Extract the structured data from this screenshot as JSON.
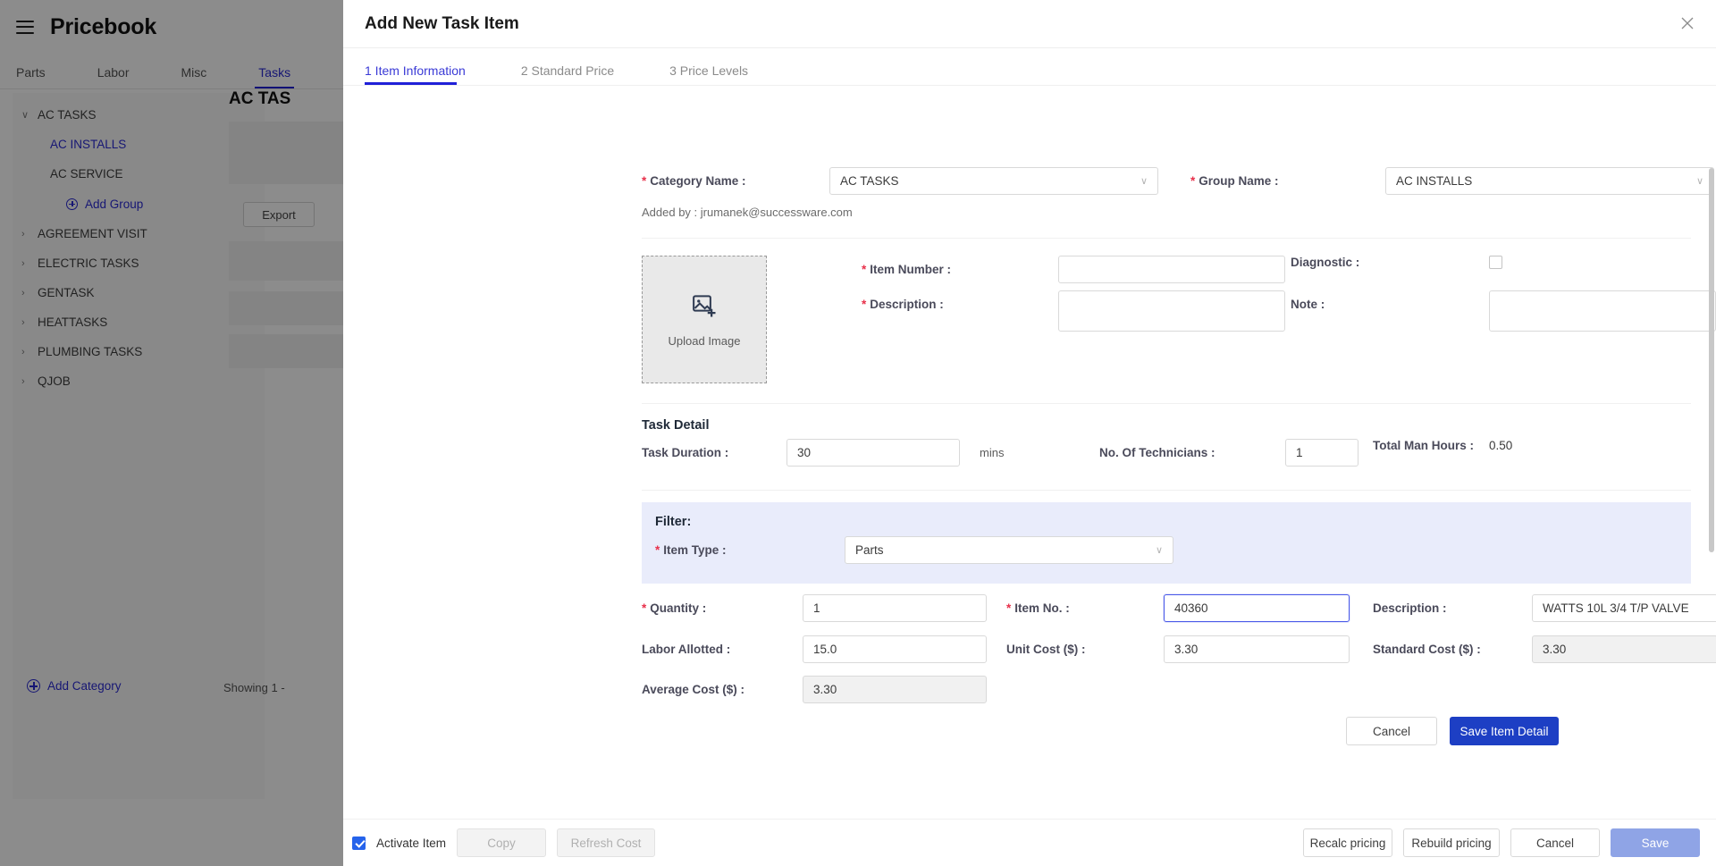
{
  "background": {
    "app_title": "Pricebook",
    "menu_icon": "hamburger-icon",
    "tabs": [
      {
        "label": "Parts",
        "active": false
      },
      {
        "label": "Labor",
        "active": false
      },
      {
        "label": "Misc",
        "active": false
      },
      {
        "label": "Tasks",
        "active": true
      }
    ],
    "tree": [
      {
        "label": "AC TASKS",
        "caret": "∨",
        "level": 0,
        "expanded": true
      },
      {
        "label": "AC INSTALLS",
        "level": 1,
        "selected": true
      },
      {
        "label": "AC SERVICE",
        "level": 1,
        "selected": false
      },
      {
        "label": "AGREEMENT VISIT",
        "caret": "›",
        "level": 0,
        "expanded": false
      },
      {
        "label": "ELECTRIC TASKS",
        "caret": "›",
        "level": 0,
        "expanded": false
      },
      {
        "label": "GENTASK",
        "caret": "›",
        "level": 0,
        "expanded": false
      },
      {
        "label": "HEATTASKS",
        "caret": "›",
        "level": 0,
        "expanded": false
      },
      {
        "label": "PLUMBING TASKS",
        "caret": "›",
        "level": 0,
        "expanded": false
      },
      {
        "label": "QJOB",
        "caret": "›",
        "level": 0,
        "expanded": false
      }
    ],
    "add_group_label": "Add Group",
    "add_category_label": "Add Category",
    "content_title": "AC TAS",
    "export_label": "Export",
    "showing_text": "Showing 1 -"
  },
  "modal": {
    "title": "Add New Task Item",
    "close_icon": "close-icon",
    "steps": [
      {
        "label": "1 Item Information",
        "active": true
      },
      {
        "label": "2 Standard Price",
        "active": false
      },
      {
        "label": "3 Price Levels",
        "active": false
      }
    ],
    "category": {
      "label": "Category Name :",
      "value": "AC TASKS",
      "required": true
    },
    "group": {
      "label": "Group Name :",
      "value": "AC INSTALLS",
      "required": true
    },
    "added_by": "Added by : jrumanek@successware.com",
    "upload": {
      "label": "Upload Image",
      "icon": "image-upload-icon"
    },
    "item_number": {
      "label": "Item Number :",
      "value": "",
      "placeholder": "",
      "required": true
    },
    "description": {
      "label": "Description :",
      "value": "",
      "placeholder": "",
      "required": true
    },
    "diagnostic": {
      "label": "Diagnostic :",
      "checked": false
    },
    "note": {
      "label": "Note :",
      "value": "",
      "placeholder": ""
    },
    "task_detail": {
      "title": "Task Detail",
      "duration_label": "Task Duration :",
      "duration_value": "30",
      "duration_unit": "mins",
      "technicians_label": "No. Of Technicians :",
      "technicians_value": "1",
      "man_hours_label": "Total Man Hours :",
      "man_hours_value": "0.50"
    },
    "filter": {
      "title": "Filter:",
      "item_type_label": "Item Type :",
      "item_type_value": "Parts",
      "required": true
    },
    "line_item": {
      "quantity_label": "Quantity :",
      "quantity_value": "1",
      "item_no_label": "Item No. :",
      "item_no_value": "40360",
      "description_label": "Description :",
      "description_value": "WATTS 10L 3/4 T/P VALVE",
      "labor_allotted_label": "Labor Allotted :",
      "labor_allotted_value": "15.0",
      "unit_cost_label": "Unit Cost ($) :",
      "unit_cost_value": "3.30",
      "standard_cost_label": "Standard Cost ($) :",
      "standard_cost_value": "3.30",
      "average_cost_label": "Average Cost ($) :",
      "average_cost_value": "3.30"
    },
    "item_actions": {
      "cancel_label": "Cancel",
      "save_item_label": "Save Item Detail"
    },
    "footer": {
      "activate_label": "Activate Item",
      "activate_checked": true,
      "copy_label": "Copy",
      "copy_disabled": true,
      "refresh_cost_label": "Refresh Cost",
      "refresh_cost_disabled": true,
      "recalc_label": "Recalc pricing",
      "rebuild_label": "Rebuild pricing",
      "cancel_label": "Cancel",
      "save_label": "Save",
      "save_disabled": true
    }
  },
  "colors": {
    "accent": "#2020d8",
    "primary_button": "#1d3fc4",
    "required_star": "#e8304a",
    "filter_band": "#e9ecfb"
  }
}
